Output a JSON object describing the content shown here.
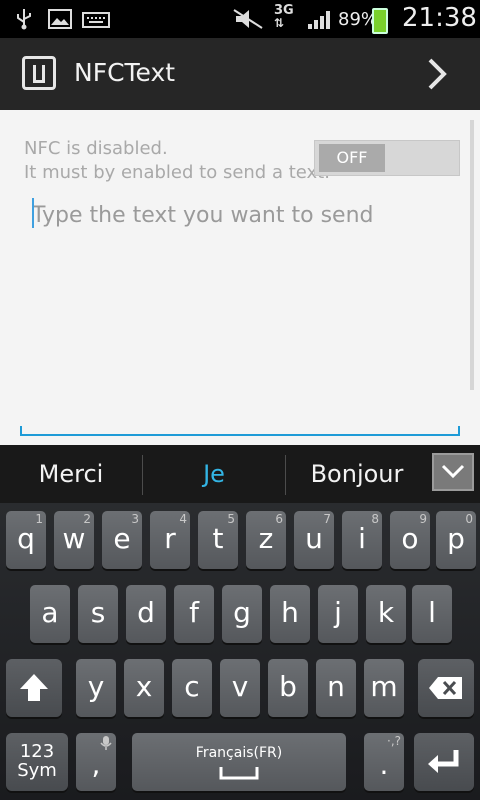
{
  "status_bar": {
    "network": "3G",
    "battery_percent": "89%",
    "time": "21:38",
    "icons": [
      "usb-icon",
      "image-icon",
      "keyboard-icon",
      "mute-icon",
      "network-3g-icon",
      "signal-icon",
      "battery-charging-icon"
    ]
  },
  "action_bar": {
    "title": "NFCText",
    "app_icon": "nfc-icon",
    "next_icon": "chevron-right-icon"
  },
  "content": {
    "nfc_status_line1": "NFC is disabled.",
    "nfc_status_line2": "It must by enabled to send a text.",
    "toggle_label": "OFF",
    "message_placeholder": "Type the text you want to send",
    "message_value": ""
  },
  "suggestions": {
    "items": [
      "Merci",
      "Je",
      "Bonjour"
    ],
    "highlight_color": "#33b5e5",
    "expand_icon": "chevron-down-icon"
  },
  "keyboard": {
    "row1": [
      {
        "ch": "q",
        "hint": "1"
      },
      {
        "ch": "w",
        "hint": "2"
      },
      {
        "ch": "e",
        "hint": "3"
      },
      {
        "ch": "r",
        "hint": "4"
      },
      {
        "ch": "t",
        "hint": "5"
      },
      {
        "ch": "z",
        "hint": "6"
      },
      {
        "ch": "u",
        "hint": "7"
      },
      {
        "ch": "i",
        "hint": "8"
      },
      {
        "ch": "o",
        "hint": "9"
      },
      {
        "ch": "p",
        "hint": "0"
      }
    ],
    "row2": [
      "a",
      "s",
      "d",
      "f",
      "g",
      "h",
      "j",
      "k",
      "l"
    ],
    "row3": [
      "y",
      "x",
      "c",
      "v",
      "b",
      "n",
      "m"
    ],
    "sym_label_1": "123",
    "sym_label_2": "Sym",
    "comma": ",",
    "period": ".",
    "space_label": "Français(FR)",
    "shift_icon": "shift-icon",
    "backspace_icon": "backspace-icon",
    "enter_icon": "enter-icon",
    "mic_icon": "mic-icon"
  }
}
